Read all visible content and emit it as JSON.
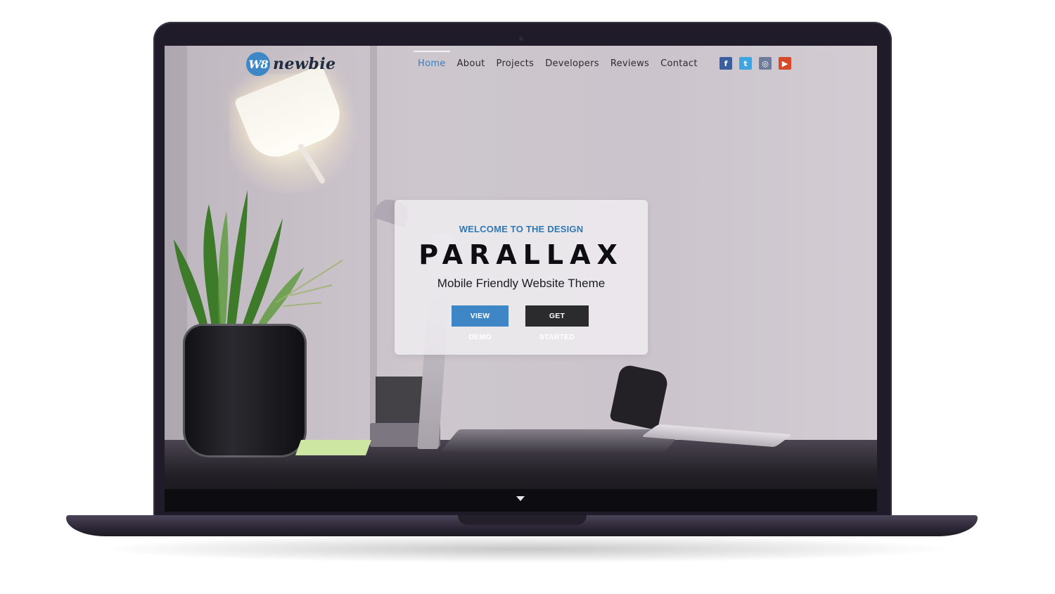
{
  "brand": {
    "logo_mark": "W8",
    "logo_text": "newbie"
  },
  "nav": {
    "items": [
      {
        "label": "Home",
        "active": true
      },
      {
        "label": "About",
        "active": false
      },
      {
        "label": "Projects",
        "active": false
      },
      {
        "label": "Developers",
        "active": false
      },
      {
        "label": "Reviews",
        "active": false
      },
      {
        "label": "Contact",
        "active": false
      }
    ],
    "active_color": "#3a7ec2"
  },
  "social": [
    {
      "name": "facebook-icon",
      "glyph": "f",
      "color": "#3b5e9e"
    },
    {
      "name": "twitter-icon",
      "glyph": "t",
      "color": "#3fa4e0"
    },
    {
      "name": "instagram-icon",
      "glyph": "◎",
      "color": "#6f7d9a"
    },
    {
      "name": "youtube-icon",
      "glyph": "▶",
      "color": "#d64a2a"
    }
  ],
  "hero": {
    "kicker": "WELCOME TO THE DESIGN",
    "title": "PARALLAX",
    "subtitle": "Mobile Friendly Website Theme",
    "primary_button": "VIEW DEMO",
    "secondary_button": "GET STARTED",
    "accent_color": "#3f86c6"
  },
  "scroll_indicator": "chevron-down-icon"
}
